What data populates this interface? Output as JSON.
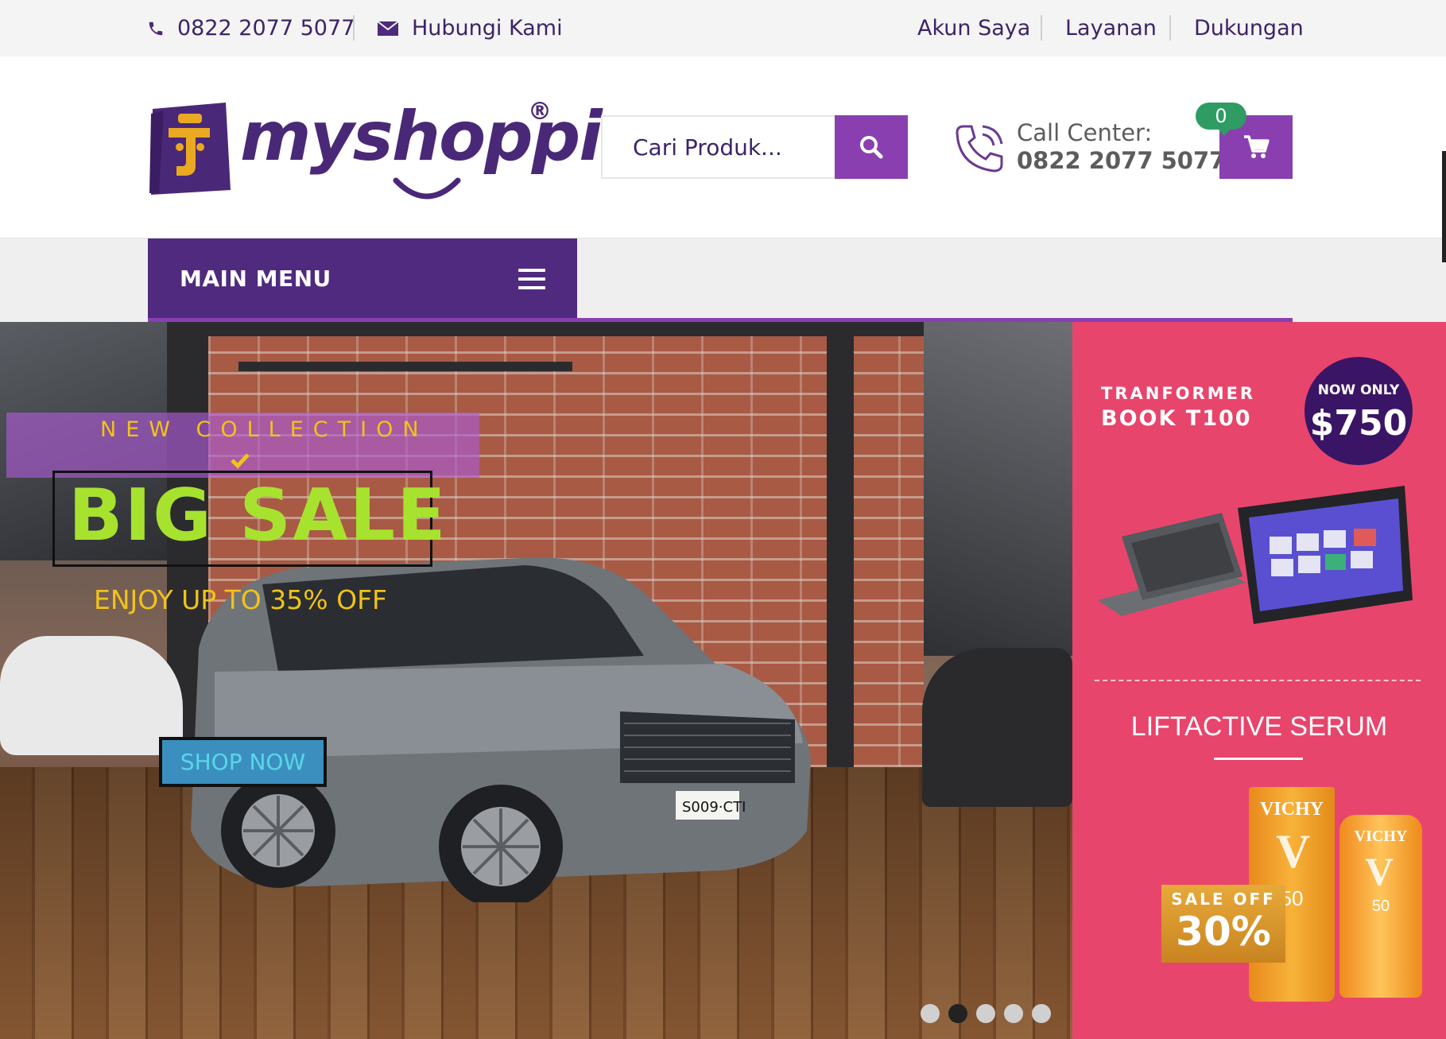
{
  "topbar": {
    "phone": "0822 2077 5077",
    "contact": "Hubungi Kami",
    "links": [
      "Akun Saya",
      "Layanan",
      "Dukungan"
    ]
  },
  "header": {
    "logo_text": "myshoppi",
    "logo_reg": "®",
    "search_placeholder": "Cari Produk...",
    "call_center_label": "Call Center:",
    "call_center_number": "0822 2077 5077",
    "cart_count": "0"
  },
  "nav": {
    "main_menu_label": "MAIN MENU"
  },
  "hero": {
    "eyebrow": "NEW COLLECTION",
    "headline": "BIG SALE",
    "subline": "ENJOY UP TO 35% OFF",
    "cta": "SHOP NOW",
    "slide_count": 5,
    "active_slide": 2
  },
  "side_banner": {
    "product_line1": "TRANFORMER",
    "product_line2": "BOOK T100",
    "price_label": "NOW ONLY",
    "price": "$750",
    "serum_title": "LIFTACTIVE SERUM",
    "sale_label": "SALE OFF",
    "sale_value": "30%",
    "brand": "VICHY",
    "spf": "50"
  },
  "colors": {
    "brand_purple": "#4f2a7e",
    "accent_purple": "#8a3fb0",
    "badge_green": "#2e9c63",
    "banner_pink": "#e8456c",
    "sale_green": "#a7e22e",
    "sale_yellow": "#f2c21a"
  },
  "icons": [
    "phone-icon",
    "envelope-icon",
    "search-icon",
    "phone-call-icon",
    "cart-icon",
    "hamburger-icon",
    "check-icon"
  ]
}
